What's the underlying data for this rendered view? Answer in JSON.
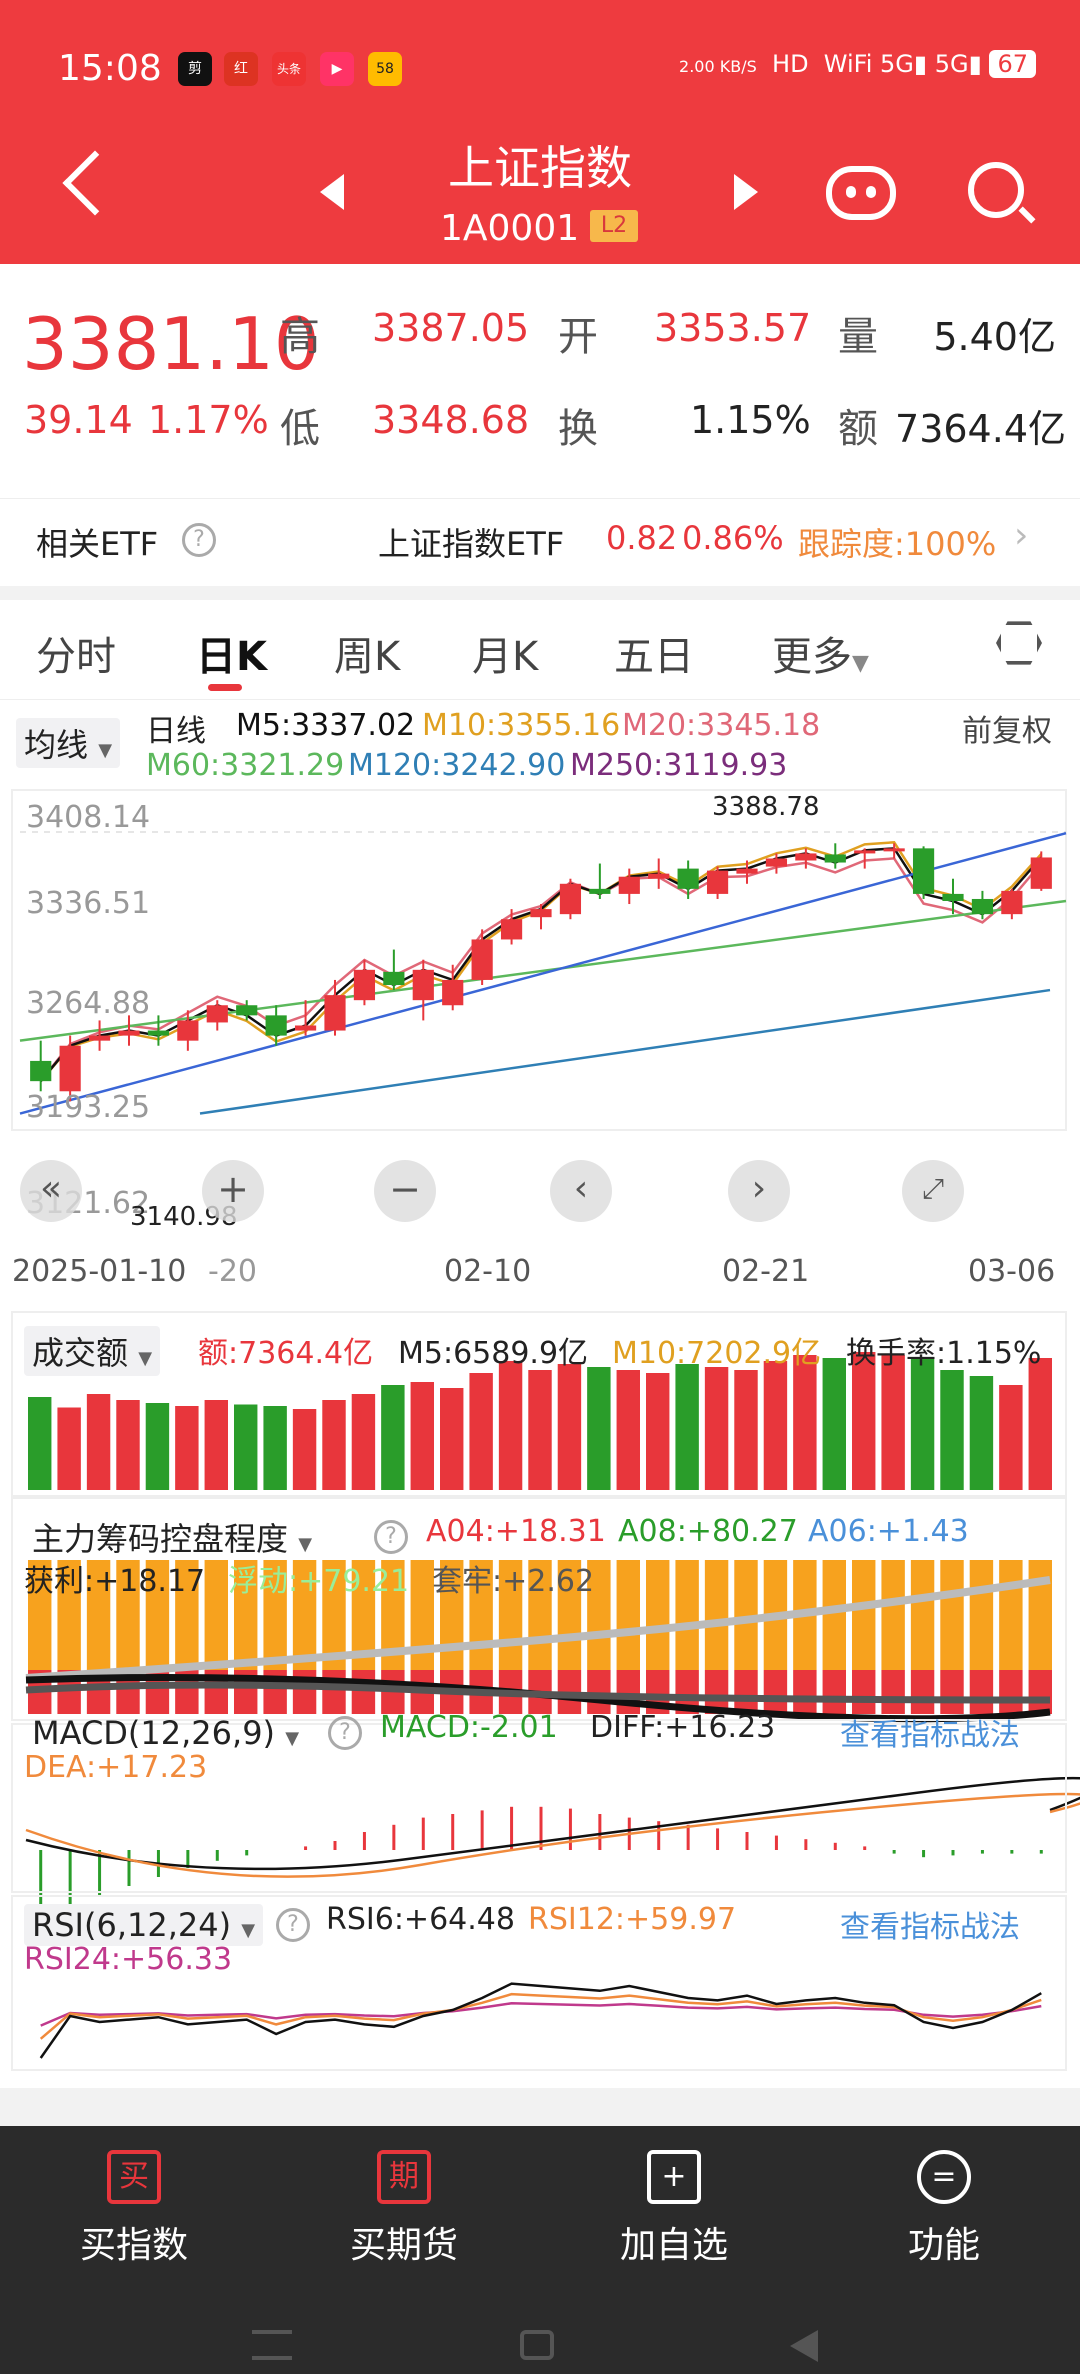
{
  "status_bar": {
    "time": "15:08",
    "speed": "2.00 KB/S",
    "battery": "67",
    "apps": [
      "剪",
      "红",
      "头条",
      "▶",
      "58"
    ]
  },
  "header": {
    "title": "上证指数",
    "code": "1A0001",
    "badge": "L2"
  },
  "quote": {
    "price": "3381.10",
    "change": "39.14",
    "change_pct": "1.17%",
    "high_label": "高",
    "high": "3387.05",
    "open_label": "开",
    "open": "3353.57",
    "vol_label": "量",
    "vol": "5.40亿",
    "low_label": "低",
    "low": "3348.68",
    "turnover_label": "换",
    "turnover": "1.15%",
    "amount_label": "额",
    "amount": "7364.4亿"
  },
  "etf": {
    "label": "相关ETF",
    "name": "上证指数ETF",
    "price": "0.82",
    "pct": "0.86%",
    "tracking": "跟踪度:100%"
  },
  "tabs": [
    "分时",
    "日K",
    "周K",
    "月K",
    "五日",
    "更多"
  ],
  "ma": {
    "selector": "均线",
    "period": "日线",
    "m5": "M5:3337.02",
    "m10": "M10:3355.16",
    "m20": "M20:3345.18",
    "m60": "M60:3321.29",
    "m120": "M120:3242.90",
    "m250": "M250:3119.93",
    "adjust": "前复权"
  },
  "price_axis": [
    "3408.14",
    "3336.51",
    "3264.88",
    "3193.25",
    "3121.62"
  ],
  "annotations": {
    "high_mark": "3388.78",
    "low_mark": "3140.98"
  },
  "date_axis": [
    "2025-01-10",
    "-20",
    "02-10",
    "02-21",
    "03-06"
  ],
  "volume": {
    "selector": "成交额",
    "amount": "额:7364.4亿",
    "m5": "M5:6589.9亿",
    "m10": "M10:7202.9亿",
    "turnover": "换手率:1.15%"
  },
  "chips": {
    "selector": "主力筹码控盘程度",
    "a04": "A04:+18.31",
    "a08": "A08:+80.27",
    "a06": "A06:+1.43",
    "profit": "获利:+18.17",
    "float": "浮动:+79.21",
    "trap": "套牢:+2.62"
  },
  "macd": {
    "selector": "MACD(12,26,9)",
    "macd": "MACD:-2.01",
    "diff": "DIFF:+16.23",
    "dea": "DEA:+17.23",
    "link": "查看指标战法"
  },
  "rsi": {
    "selector": "RSI(6,12,24)",
    "rsi6": "RSI6:+64.48",
    "rsi12": "RSI12:+59.97",
    "rsi24": "RSI24:+56.33",
    "link": "查看指标战法"
  },
  "bottom_nav": [
    {
      "icon": "买",
      "label": "买指数"
    },
    {
      "icon": "期",
      "label": "买期货"
    },
    {
      "icon": "+",
      "label": "加自选"
    },
    {
      "icon": "=",
      "label": "功能"
    }
  ],
  "colors": {
    "up": "#e8363c",
    "down": "#2a9d2a",
    "header": "#ee3b3f",
    "m5": "#111111",
    "m10": "#e0a020",
    "m20": "#e06878",
    "m60": "#5cb85c",
    "m120": "#2f7fb5",
    "m250": "#7b2d7b"
  },
  "chart_data": {
    "type": "candlestick",
    "dates": [
      "2025-01-10",
      "01-20",
      "02-10",
      "02-21",
      "03-06"
    ],
    "ylim": [
      3121.62,
      3408.14
    ],
    "ohlc": [
      [
        3180,
        3200,
        3150,
        3160
      ],
      [
        3150,
        3205,
        3140,
        3195
      ],
      [
        3200,
        3220,
        3190,
        3205
      ],
      [
        3205,
        3225,
        3195,
        3210
      ],
      [
        3210,
        3225,
        3195,
        3205
      ],
      [
        3200,
        3230,
        3190,
        3220
      ],
      [
        3218,
        3240,
        3210,
        3235
      ],
      [
        3235,
        3240,
        3220,
        3225
      ],
      [
        3225,
        3235,
        3195,
        3205
      ],
      [
        3210,
        3240,
        3205,
        3215
      ],
      [
        3210,
        3260,
        3205,
        3245
      ],
      [
        3240,
        3280,
        3235,
        3270
      ],
      [
        3268,
        3290,
        3250,
        3255
      ],
      [
        3240,
        3280,
        3220,
        3270
      ],
      [
        3235,
        3275,
        3230,
        3260
      ],
      [
        3260,
        3310,
        3255,
        3300
      ],
      [
        3300,
        3330,
        3295,
        3320
      ],
      [
        3322,
        3335,
        3310,
        3330
      ],
      [
        3325,
        3360,
        3320,
        3355
      ],
      [
        3350,
        3375,
        3340,
        3345
      ],
      [
        3345,
        3370,
        3335,
        3362
      ],
      [
        3360,
        3380,
        3350,
        3365
      ],
      [
        3370,
        3378,
        3340,
        3350
      ],
      [
        3345,
        3372,
        3340,
        3368
      ],
      [
        3365,
        3378,
        3355,
        3370
      ],
      [
        3372,
        3385,
        3365,
        3380
      ],
      [
        3378,
        3390,
        3370,
        3385
      ],
      [
        3384,
        3395,
        3370,
        3376
      ],
      [
        3385,
        3390,
        3370,
        3388
      ],
      [
        3388,
        3395,
        3380,
        3390
      ],
      [
        3390,
        3392,
        3340,
        3345
      ],
      [
        3345,
        3360,
        3325,
        3338
      ],
      [
        3340,
        3348,
        3320,
        3325
      ],
      [
        3325,
        3350,
        3320,
        3348
      ],
      [
        3350,
        3387,
        3348,
        3381
      ]
    ],
    "volume": [
      62,
      55,
      64,
      60,
      58,
      56,
      60,
      57,
      56,
      54,
      60,
      64,
      70,
      72,
      68,
      78,
      86,
      80,
      84,
      82,
      80,
      78,
      84,
      82,
      80,
      86,
      90,
      88,
      92,
      90,
      88,
      80,
      76,
      70,
      88
    ],
    "macd_hist": [
      -35,
      -30,
      -25,
      -20,
      -15,
      -10,
      -6,
      -3,
      0,
      2,
      5,
      10,
      14,
      18,
      20,
      22,
      24,
      24,
      23,
      20,
      18,
      16,
      14,
      12,
      10,
      8,
      6,
      4,
      2,
      -2,
      -4,
      -3,
      -2,
      -2,
      -2
    ],
    "rsi6": [
      10,
      45,
      40,
      42,
      44,
      38,
      40,
      42,
      30,
      40,
      42,
      38,
      36,
      45,
      50,
      60,
      72,
      70,
      68,
      66,
      70,
      65,
      60,
      58,
      62,
      55,
      58,
      60,
      56,
      54,
      40,
      35,
      40,
      50,
      64
    ]
  }
}
